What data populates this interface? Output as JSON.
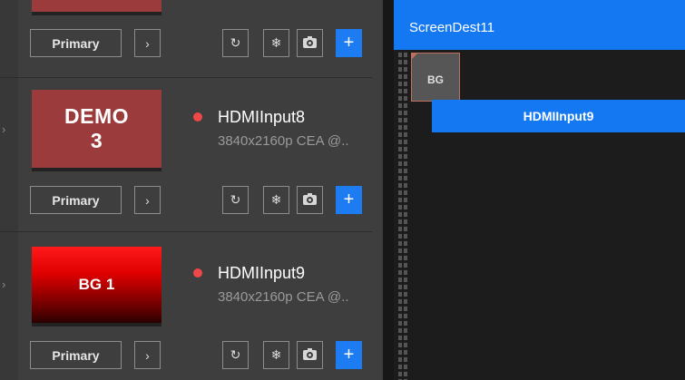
{
  "left_panel": {
    "cards": [
      {
        "thumbnail_text": "",
        "name": "",
        "resolution": "",
        "primary_label": "Primary"
      },
      {
        "thumbnail_line1": "DEMO",
        "thumbnail_line2": "3",
        "name": "HDMIInput8",
        "resolution": "3840x2160p CEA @..",
        "primary_label": "Primary"
      },
      {
        "thumbnail_text": "BG 1",
        "name": "HDMIInput9",
        "resolution": "3840x2160p CEA @..",
        "primary_label": "Primary"
      }
    ],
    "icons": {
      "chevron": "›",
      "refresh": "↻",
      "freeze": "❄",
      "add": "+"
    }
  },
  "right_panel": {
    "screen_name": "ScreenDest11",
    "bg_layer_label": "BG",
    "layer_label": "HDMIInput9"
  },
  "colors": {
    "accent_blue": "#1478f2",
    "status_red": "#f04848",
    "demo_thumb": "#9b3b3b"
  }
}
